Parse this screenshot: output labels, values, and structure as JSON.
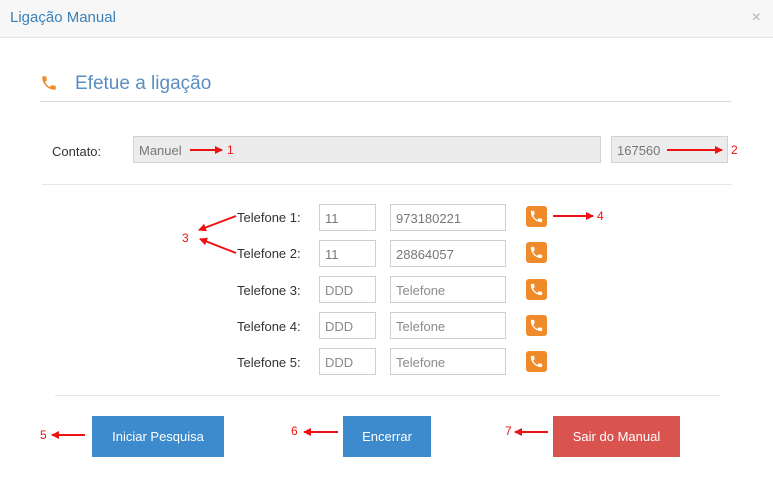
{
  "window": {
    "title": "Ligação Manual",
    "close_symbol": "×"
  },
  "section": {
    "heading": "Efetue a ligação"
  },
  "contact": {
    "label": "Contato:",
    "name": "Manuel",
    "code": "167560"
  },
  "phones": [
    {
      "label": "Telefone 1:",
      "ddd": "11",
      "number": "973180221"
    },
    {
      "label": "Telefone 2:",
      "ddd": "11",
      "number": "28864057"
    },
    {
      "label": "Telefone 3:",
      "ddd_placeholder": "DDD",
      "number_placeholder": "Telefone"
    },
    {
      "label": "Telefone 4:",
      "ddd_placeholder": "DDD",
      "number_placeholder": "Telefone"
    },
    {
      "label": "Telefone 5:",
      "ddd_placeholder": "DDD",
      "number_placeholder": "Telefone"
    }
  ],
  "buttons": {
    "start_search": "Iniciar Pesquisa",
    "close_call": "Encerrar",
    "exit_manual": "Sair do Manual"
  },
  "annotations": [
    "1",
    "2",
    "3",
    "4",
    "5",
    "6",
    "7"
  ],
  "colors": {
    "accent_orange": "#f08b2c",
    "title_blue": "#3b80b8",
    "button_blue": "#3d8acc",
    "button_red": "#d9534f",
    "annotation_red": "#ee1111"
  }
}
